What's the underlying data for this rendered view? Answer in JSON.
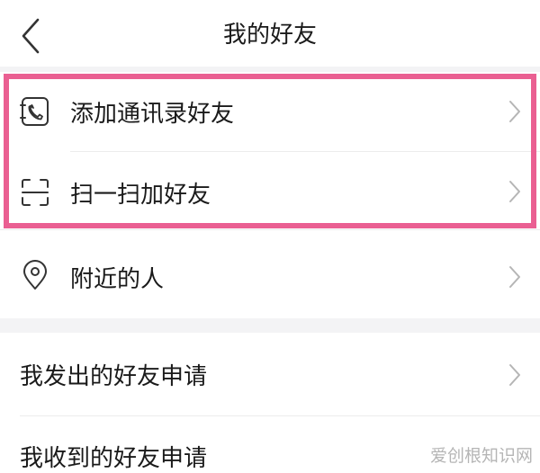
{
  "header": {
    "title": "我的好友",
    "back_icon": "chevron-left-icon"
  },
  "menu": {
    "contacts": {
      "label": "添加通讯录好友",
      "icon": "contacts-phone-icon"
    },
    "scan": {
      "label": "扫一扫加好友",
      "icon": "scan-icon"
    },
    "nearby": {
      "label": "附近的人",
      "icon": "location-pin-icon"
    },
    "sent_requests": {
      "label": "我发出的好友申请"
    },
    "received_requests": {
      "label": "我收到的好友申请"
    }
  },
  "highlight": {
    "color": "#ea5f92"
  },
  "watermark": {
    "text": "爱创根知识网"
  }
}
